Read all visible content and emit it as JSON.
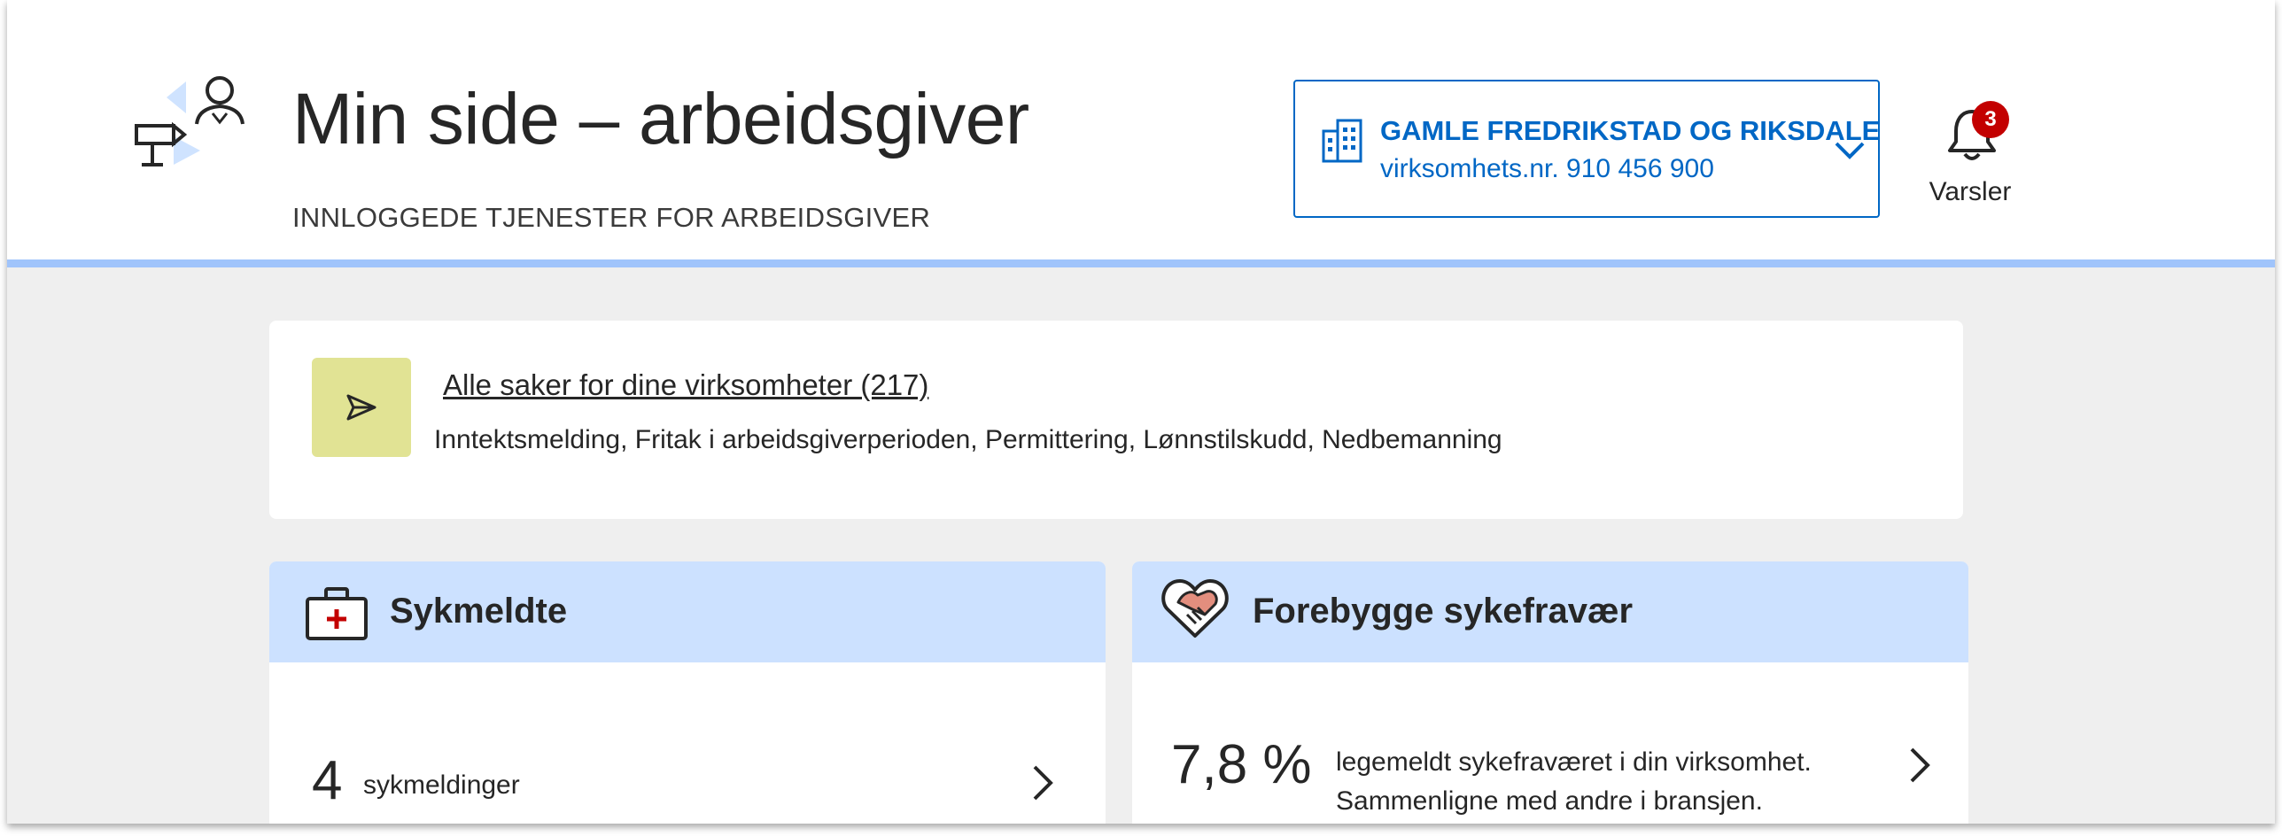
{
  "header": {
    "title": "Min side – arbeidsgiver",
    "subtitle": "INNLOGGEDE TJENESTER FOR ARBEIDSGIVER",
    "illustration_icon": "signpost-person-icon",
    "org_selector": {
      "name": "GAMLE FREDRIKSTAD OG RIKSDALE",
      "number_text": "virksomhets.nr. 910 456 900",
      "icon": "building-icon",
      "chevron_icon": "chevron-down-icon"
    },
    "notifications": {
      "label": "Varsler",
      "count": "3",
      "icon": "bell-icon"
    }
  },
  "cases": {
    "icon": "paper-plane-icon",
    "link_text": "Alle saker for dine virksomheter (217)",
    "description": "Inntektsmelding, Fritak i arbeidsgiverperioden, Permittering, Lønnstilskudd, Nedbemanning"
  },
  "panels": {
    "sick_leave": {
      "title": "Sykmeldte",
      "icon": "first-aid-kit-icon",
      "count": "4",
      "count_label": "sykmeldinger",
      "arrow_icon": "chevron-right-icon"
    },
    "prevent_absence": {
      "title": "Forebygge sykefravær",
      "icon": "heart-handshake-icon",
      "percent": "7,8 %",
      "line1": "legemeldt sykefraværet i din virksomhet.",
      "line2": "Sammenligne med andre i bransjen.",
      "arrow_icon": "chevron-right-icon"
    }
  },
  "colors": {
    "accent_blue": "#0067c5",
    "header_border": "#a0c4fb",
    "panel_header": "#cce1ff",
    "cases_icon_bg": "#e1e394",
    "badge_red": "#c30000",
    "page_bg": "#efefef"
  }
}
